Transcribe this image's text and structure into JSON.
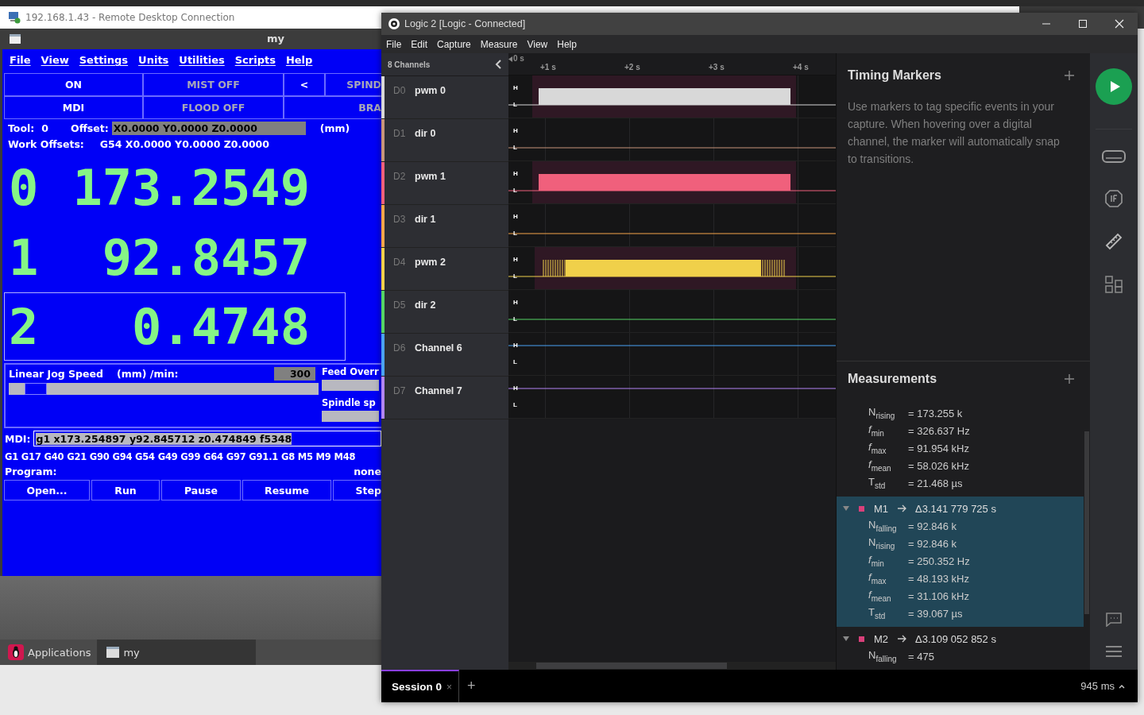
{
  "rdp": {
    "title": "192.168.1.43 - Remote Desktop Connection"
  },
  "cnc": {
    "window_title": "my",
    "menu": [
      "File",
      "View",
      "Settings",
      "Units",
      "Utilities",
      "Scripts",
      "Help"
    ],
    "button_rows": [
      [
        {
          "label": "ON",
          "active": true
        },
        {
          "label": "MIST OFF",
          "active": false
        },
        {
          "label": "<",
          "active": true
        },
        {
          "label": "SPIND",
          "active": false
        }
      ],
      [
        {
          "label": "MDI",
          "active": true
        },
        {
          "label": "FLOOD OFF",
          "active": false
        },
        {
          "label": "BRA",
          "active": false
        }
      ]
    ],
    "tool_label": "Tool:",
    "tool_value": "0",
    "offset_label": "Offset:",
    "offset_value": "X0.0000 Y0.0000 Z0.0000",
    "units": "(mm)",
    "work_offsets_label": "Work Offsets:",
    "work_offsets_value": "G54 X0.0000 Y0.0000 Z0.0000",
    "positions": [
      {
        "axis": "0",
        "value": "173.2549",
        "selected": false
      },
      {
        "axis": "1",
        "value": "92.8457",
        "selected": false
      },
      {
        "axis": "2",
        "value": "0.4748",
        "selected": true
      }
    ],
    "jog": {
      "label": "Linear Jog Speed",
      "unit": "(mm) /min:",
      "value": "300",
      "level": 0.05
    },
    "feed_override_label": "Feed Overr",
    "spindle_label": "Spindle sp",
    "mdi_label": "MDI:",
    "mdi_value": "g1 x173.254897 y92.845712 z0.474849 f5348",
    "gcodes": "G1 G17 G40 G21 G90 G94 G54 G49 G99 G64 G97 G91.1 G8 M5 M9 M48",
    "program_label": "Program:",
    "program_value": "none",
    "program_buttons": [
      "Open...",
      "Run",
      "Pause",
      "Resume",
      "Step"
    ]
  },
  "taskbar": [
    {
      "label": "Applications",
      "kind": "menu"
    },
    {
      "label": "my",
      "kind": "window"
    }
  ],
  "logic": {
    "title": "Logic 2 [Logic - Connected]",
    "menu": [
      "File",
      "Edit",
      "Capture",
      "Measure",
      "View",
      "Help"
    ],
    "channels_header": "8 Channels",
    "start": "0 s",
    "ticks": [
      "+1 s",
      "+2 s",
      "+3 s",
      "+4 s"
    ],
    "channels": [
      {
        "id": "D0",
        "name": "pwm 0",
        "color": "#d8d8d8",
        "kind": "pulse",
        "high": "H",
        "low": "L"
      },
      {
        "id": "D1",
        "name": "dir 0",
        "color": "#c8957a",
        "kind": "low",
        "high": "H",
        "low": "L"
      },
      {
        "id": "D2",
        "name": "pwm 1",
        "color": "#f0607c",
        "kind": "pulse",
        "high": "H",
        "low": "L"
      },
      {
        "id": "D3",
        "name": "dir 1",
        "color": "#f5a54a",
        "kind": "low",
        "high": "H",
        "low": "L"
      },
      {
        "id": "D4",
        "name": "pwm 2",
        "color": "#f0d04a",
        "kind": "burst",
        "high": "H",
        "low": "L"
      },
      {
        "id": "D5",
        "name": "dir 2",
        "color": "#55d565",
        "kind": "low",
        "high": "H",
        "low": "L"
      },
      {
        "id": "D6",
        "name": "Channel 6",
        "color": "#4aa3f5",
        "kind": "high",
        "high": "H",
        "low": "L"
      },
      {
        "id": "D7",
        "name": "Channel 7",
        "color": "#b385f5",
        "kind": "high",
        "high": "H",
        "low": "L"
      }
    ],
    "timing_markers": {
      "title": "Timing Markers",
      "text": "Use markers to tag specific events in your capture. When hovering over a digital channel, the marker will automatically snap to transitions."
    },
    "measurements": {
      "title": "Measurements",
      "groups": [
        {
          "selected": false,
          "rows": [
            {
              "label": "N$_{rising}$",
              "value": "= 173.255 k"
            },
            {
              "label": "*f*$_{min}$",
              "value": "= 326.637 Hz"
            },
            {
              "label": "*f*$_{max}$",
              "value": "= 91.954 kHz"
            },
            {
              "label": "*f*$_{mean}$",
              "value": "= 58.026 kHz"
            },
            {
              "label": "T$_{std}$",
              "value": "= 21.468 µs"
            }
          ]
        },
        {
          "name": "M1",
          "delta": "Δ3.141 779 725 s",
          "color": "#d9407a",
          "selected": true,
          "expanded": true,
          "rows": [
            {
              "label": "N$_{falling}$",
              "value": "= 92.846 k"
            },
            {
              "label": "N$_{rising}$",
              "value": "= 92.846 k"
            },
            {
              "label": "*f*$_{min}$",
              "value": "= 250.352 Hz"
            },
            {
              "label": "*f*$_{max}$",
              "value": "= 48.193 kHz"
            },
            {
              "label": "*f*$_{mean}$",
              "value": "= 31.106 kHz"
            },
            {
              "label": "T$_{std}$",
              "value": "= 39.067 µs"
            }
          ]
        },
        {
          "name": "M2",
          "delta": "Δ3.109 052 852 s",
          "color": "#d9407a",
          "selected": false,
          "expanded": true,
          "rows": [
            {
              "label": "N$_{falling}$",
              "value": "= 475"
            }
          ]
        }
      ]
    },
    "sessions": [
      {
        "label": "Session 0",
        "close": "×",
        "selected": true
      }
    ],
    "add_session": "+",
    "duration": "945 ms"
  }
}
